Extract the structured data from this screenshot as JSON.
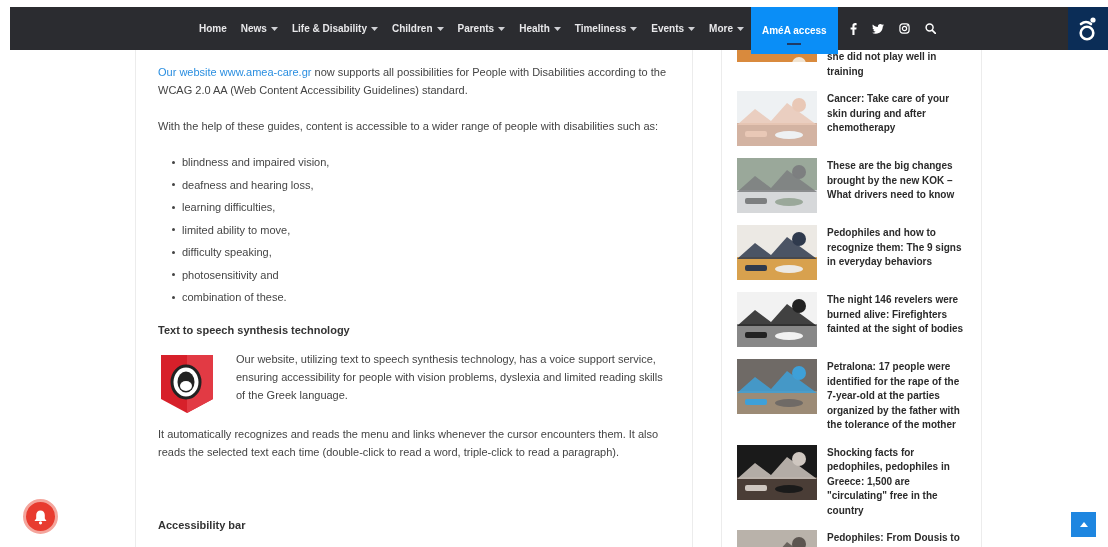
{
  "nav": {
    "items": [
      {
        "label": "Home",
        "dropdown": false,
        "selected": false
      },
      {
        "label": "News",
        "dropdown": true,
        "selected": false
      },
      {
        "label": "Life & Disability",
        "dropdown": true,
        "selected": false
      },
      {
        "label": "Children",
        "dropdown": true,
        "selected": false
      },
      {
        "label": "Parents",
        "dropdown": true,
        "selected": false
      },
      {
        "label": "Health",
        "dropdown": true,
        "selected": false
      },
      {
        "label": "Timeliness",
        "dropdown": true,
        "selected": false
      },
      {
        "label": "Events",
        "dropdown": true,
        "selected": false
      },
      {
        "label": "More",
        "dropdown": true,
        "selected": false
      },
      {
        "label": "AméA access",
        "dropdown": false,
        "selected": true
      }
    ],
    "social": [
      {
        "kind": "facebook"
      },
      {
        "kind": "twitter"
      },
      {
        "kind": "instagram"
      },
      {
        "kind": "search"
      }
    ]
  },
  "article": {
    "intro": {
      "link": "Our website www.amea-care.gr",
      "text": " now supports all possibilities for People with Disabilities according to the WCAG 2.0 AA (Web Content Accessibility Guidelines) standard."
    },
    "lead": "With the help of these guides, content is accessible to a wider range of people with disabilities such as:",
    "bullets": [
      "blindness and impaired vision,",
      "deafness and hearing loss,",
      "learning difficulties,",
      "limited ability to move,",
      "difficulty speaking,",
      "photosensitivity and",
      "combination of these."
    ],
    "tts_heading": "Text to speech synthesis technology",
    "tts_text": "Our website, utilizing text to speech synthesis technology, has a voice support service, ensuring accessibility for people with vision problems, dyslexia and limited reading skills of the Greek language.",
    "tts_more": "It automatically recognizes and reads the menu and links whenever the cursor encounters them. It also reads the selected text each time (double-click to read a word, triple-click to read a paragraph).",
    "bar_heading": "Accessibility bar"
  },
  "sidebar": {
    "items": [
      {
        "title": "she did not play well in training"
      },
      {
        "title": "Cancer: Take care of your skin during and after chemotherapy"
      },
      {
        "title": "These are the big changes brought by the new KOK – What drivers need to know"
      },
      {
        "title": "Pedophiles and how to recognize them: The 9 signs in everyday behaviors"
      },
      {
        "title": "The night 146 revelers were burned alive: Firefighters fainted at the sight of bodies"
      },
      {
        "title": "Petralona: 17 people were identified for the rape of the 7-year-old at the parties organized by the father with the tolerance of the mother"
      },
      {
        "title": "Shocking facts for pedophiles, pedophiles in Greece: 1,500 are \"circulating\" free in the country"
      },
      {
        "title": "Pedophiles: From Dousis to"
      }
    ]
  }
}
